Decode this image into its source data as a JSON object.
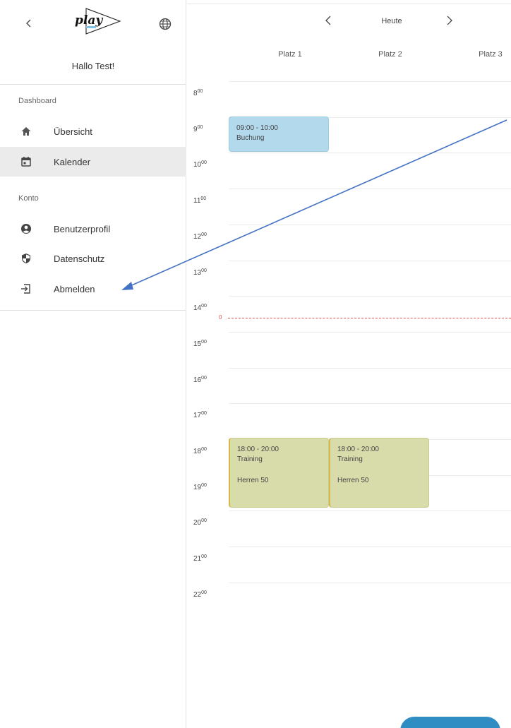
{
  "sidebar": {
    "greeting": "Hallo Test!",
    "logo_text": "play",
    "sections": [
      {
        "label": "Dashboard"
      },
      {
        "label": "Konto"
      }
    ],
    "items": [
      {
        "label": "Übersicht",
        "icon": "home-icon"
      },
      {
        "label": "Kalender",
        "icon": "calendar-icon",
        "active": true
      },
      {
        "label": "Benutzerprofil",
        "icon": "account-circle-icon"
      },
      {
        "label": "Datenschutz",
        "icon": "shield-icon"
      },
      {
        "label": "Abmelden",
        "icon": "logout-icon"
      }
    ]
  },
  "calendar": {
    "today_label": "Heute",
    "courts": [
      "Platz 1",
      "Platz 2",
      "Platz 3"
    ],
    "hours": [
      "8",
      "9",
      "10",
      "11",
      "12",
      "13",
      "14",
      "15",
      "16",
      "17",
      "18",
      "19",
      "20",
      "21",
      "22"
    ],
    "minutes": "00",
    "now_marker": "0",
    "events": [
      {
        "time": "09:00 - 10:00",
        "title": "Buchung",
        "detail": "",
        "color": "#b3d9ec"
      },
      {
        "time": "18:00 - 20:00",
        "title": "Training",
        "detail": "Herren 50",
        "color": "#d8dbaa"
      },
      {
        "time": "18:00 - 20:00",
        "title": "Training",
        "detail": "Herren 50",
        "color": "#d8dbaa"
      }
    ]
  },
  "colors": {
    "accent": "#2f8dc4",
    "now_line": "#e05050",
    "annotation_arrow": "#4472c4"
  }
}
